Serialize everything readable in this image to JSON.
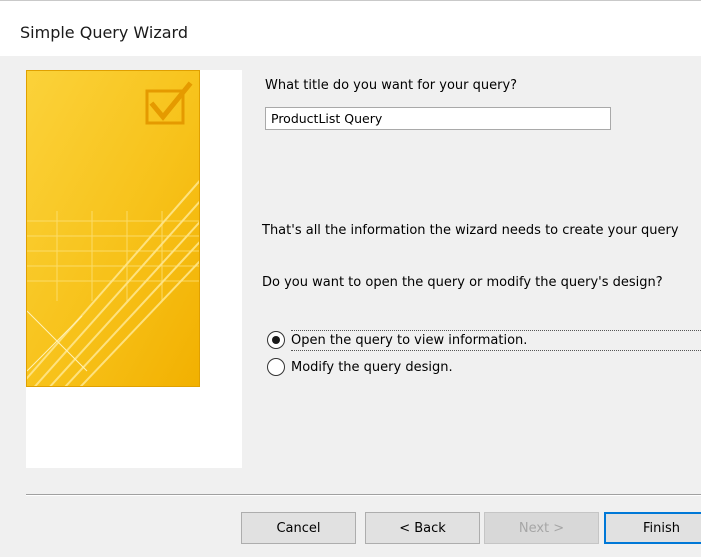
{
  "window": {
    "title": "Simple Query Wizard"
  },
  "form": {
    "title_prompt": "What title do you want for your query?",
    "title_value": "ProductList Query",
    "info_text": "That's all the information the wizard needs to create your query",
    "choice_prompt": "Do you want to open the query or modify the query's design?",
    "options": [
      {
        "label": "Open the query to view information.",
        "selected": true
      },
      {
        "label": "Modify the query design.",
        "selected": false
      }
    ]
  },
  "buttons": {
    "cancel": "Cancel",
    "back": "< Back",
    "next": "Next >",
    "finish": "Finish"
  },
  "colors": {
    "art_yellow": "#f7c71a",
    "art_dark": "#f0a800",
    "default_button_border": "#0078d7"
  }
}
